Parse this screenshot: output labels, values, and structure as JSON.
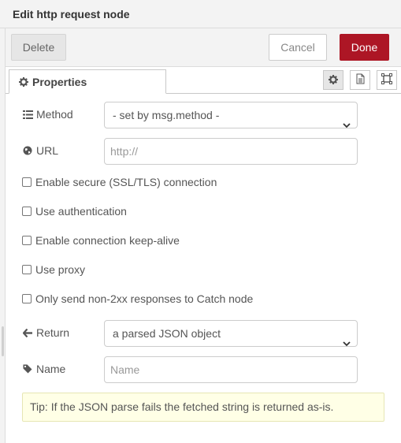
{
  "header": {
    "title": "Edit http request node"
  },
  "toolbar": {
    "delete_label": "Delete",
    "cancel_label": "Cancel",
    "done_label": "Done"
  },
  "tabs": {
    "properties_label": "Properties"
  },
  "form": {
    "method": {
      "label": "Method",
      "value": "- set by msg.method -"
    },
    "url": {
      "label": "URL",
      "placeholder": "http://"
    },
    "checkboxes": [
      {
        "label": "Enable secure (SSL/TLS) connection",
        "checked": false
      },
      {
        "label": "Use authentication",
        "checked": false
      },
      {
        "label": "Enable connection keep-alive",
        "checked": false
      },
      {
        "label": "Use proxy",
        "checked": false
      },
      {
        "label": "Only send non-2xx responses to Catch node",
        "checked": false
      }
    ],
    "return": {
      "label": "Return",
      "value": "a parsed JSON object"
    },
    "name": {
      "label": "Name",
      "placeholder": "Name"
    }
  },
  "tip": "Tip: If the JSON parse fails the fetched string is returned as-is.",
  "colors": {
    "done": "#ad1625",
    "tip_bg": "#ffffe6"
  },
  "icons": [
    "cog-icon",
    "description-icon",
    "appearance-icon",
    "list-icon",
    "globe-icon",
    "arrow-left-icon",
    "tag-icon"
  ]
}
